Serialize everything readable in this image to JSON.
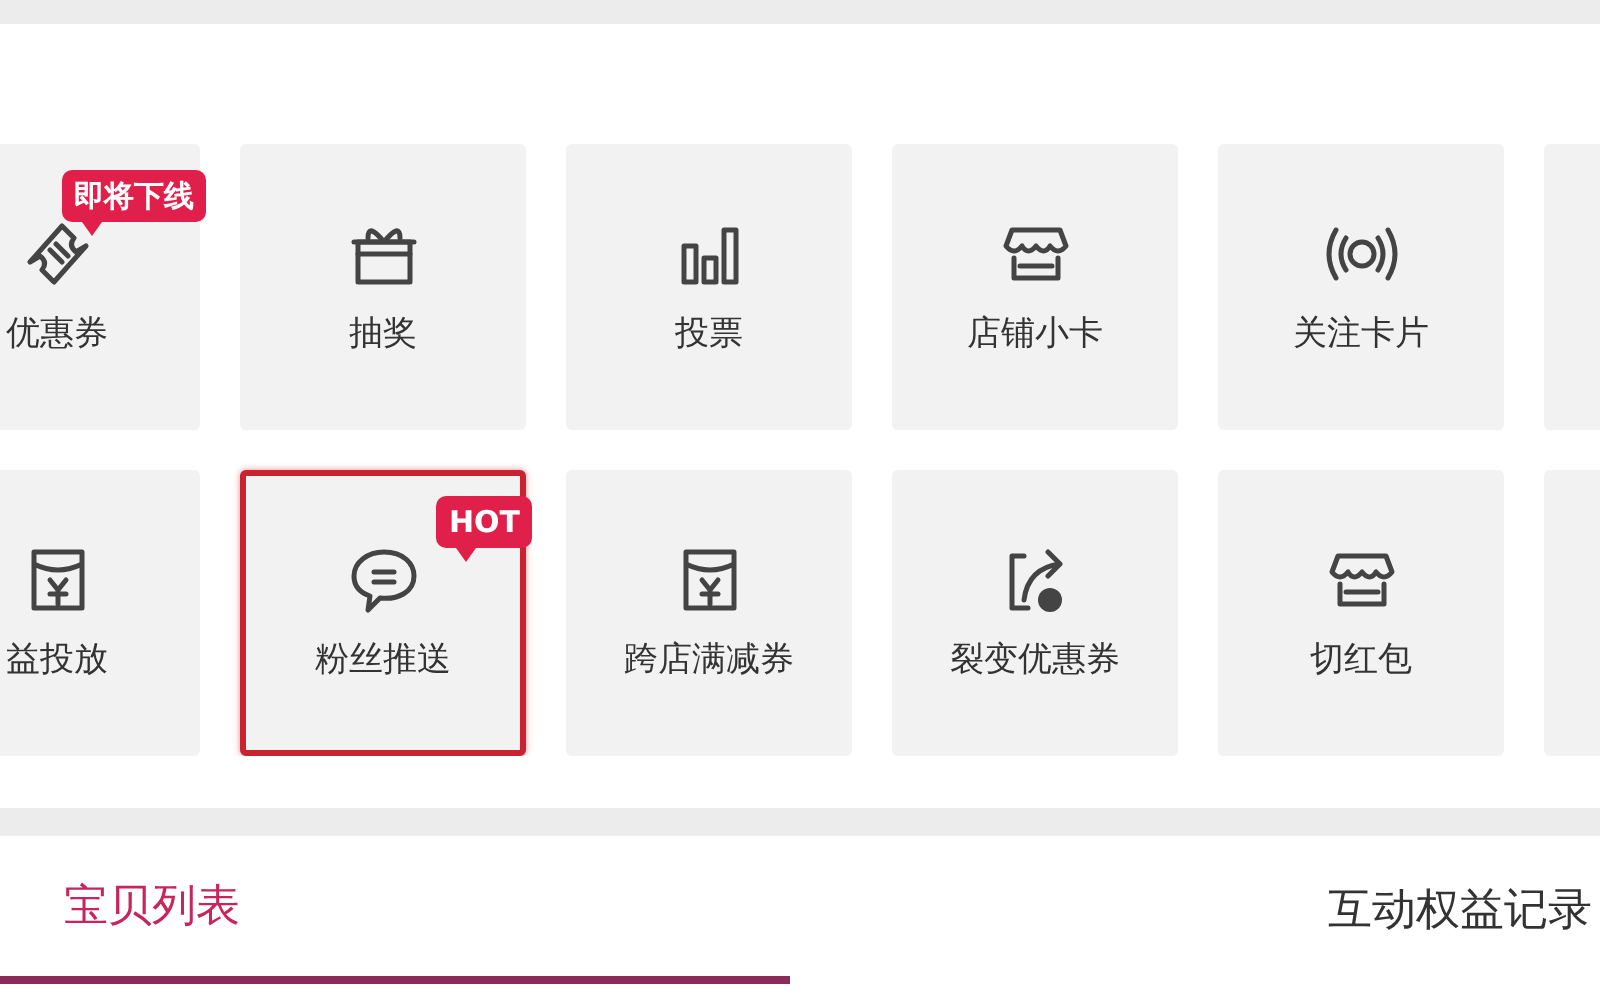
{
  "tools": [
    [
      {
        "label": "优惠券",
        "selected": false,
        "badge": "即将下线"
      },
      {
        "label": "抽奖",
        "selected": false
      },
      {
        "label": "投票",
        "selected": false
      },
      {
        "label": "店铺小卡",
        "selected": false
      },
      {
        "label": "关注卡片",
        "selected": false
      }
    ],
    [
      {
        "label": "益投放",
        "selected": false
      },
      {
        "label": "粉丝推送",
        "selected": true,
        "badge": "HOT"
      },
      {
        "label": "跨店满减券",
        "selected": false
      },
      {
        "label": "裂变优惠券",
        "selected": false
      },
      {
        "label": "切红包",
        "selected": false
      }
    ]
  ],
  "tabs": [
    {
      "label": "宝贝列表",
      "selected": true
    },
    {
      "label": "互动权益记录",
      "selected": false
    }
  ]
}
